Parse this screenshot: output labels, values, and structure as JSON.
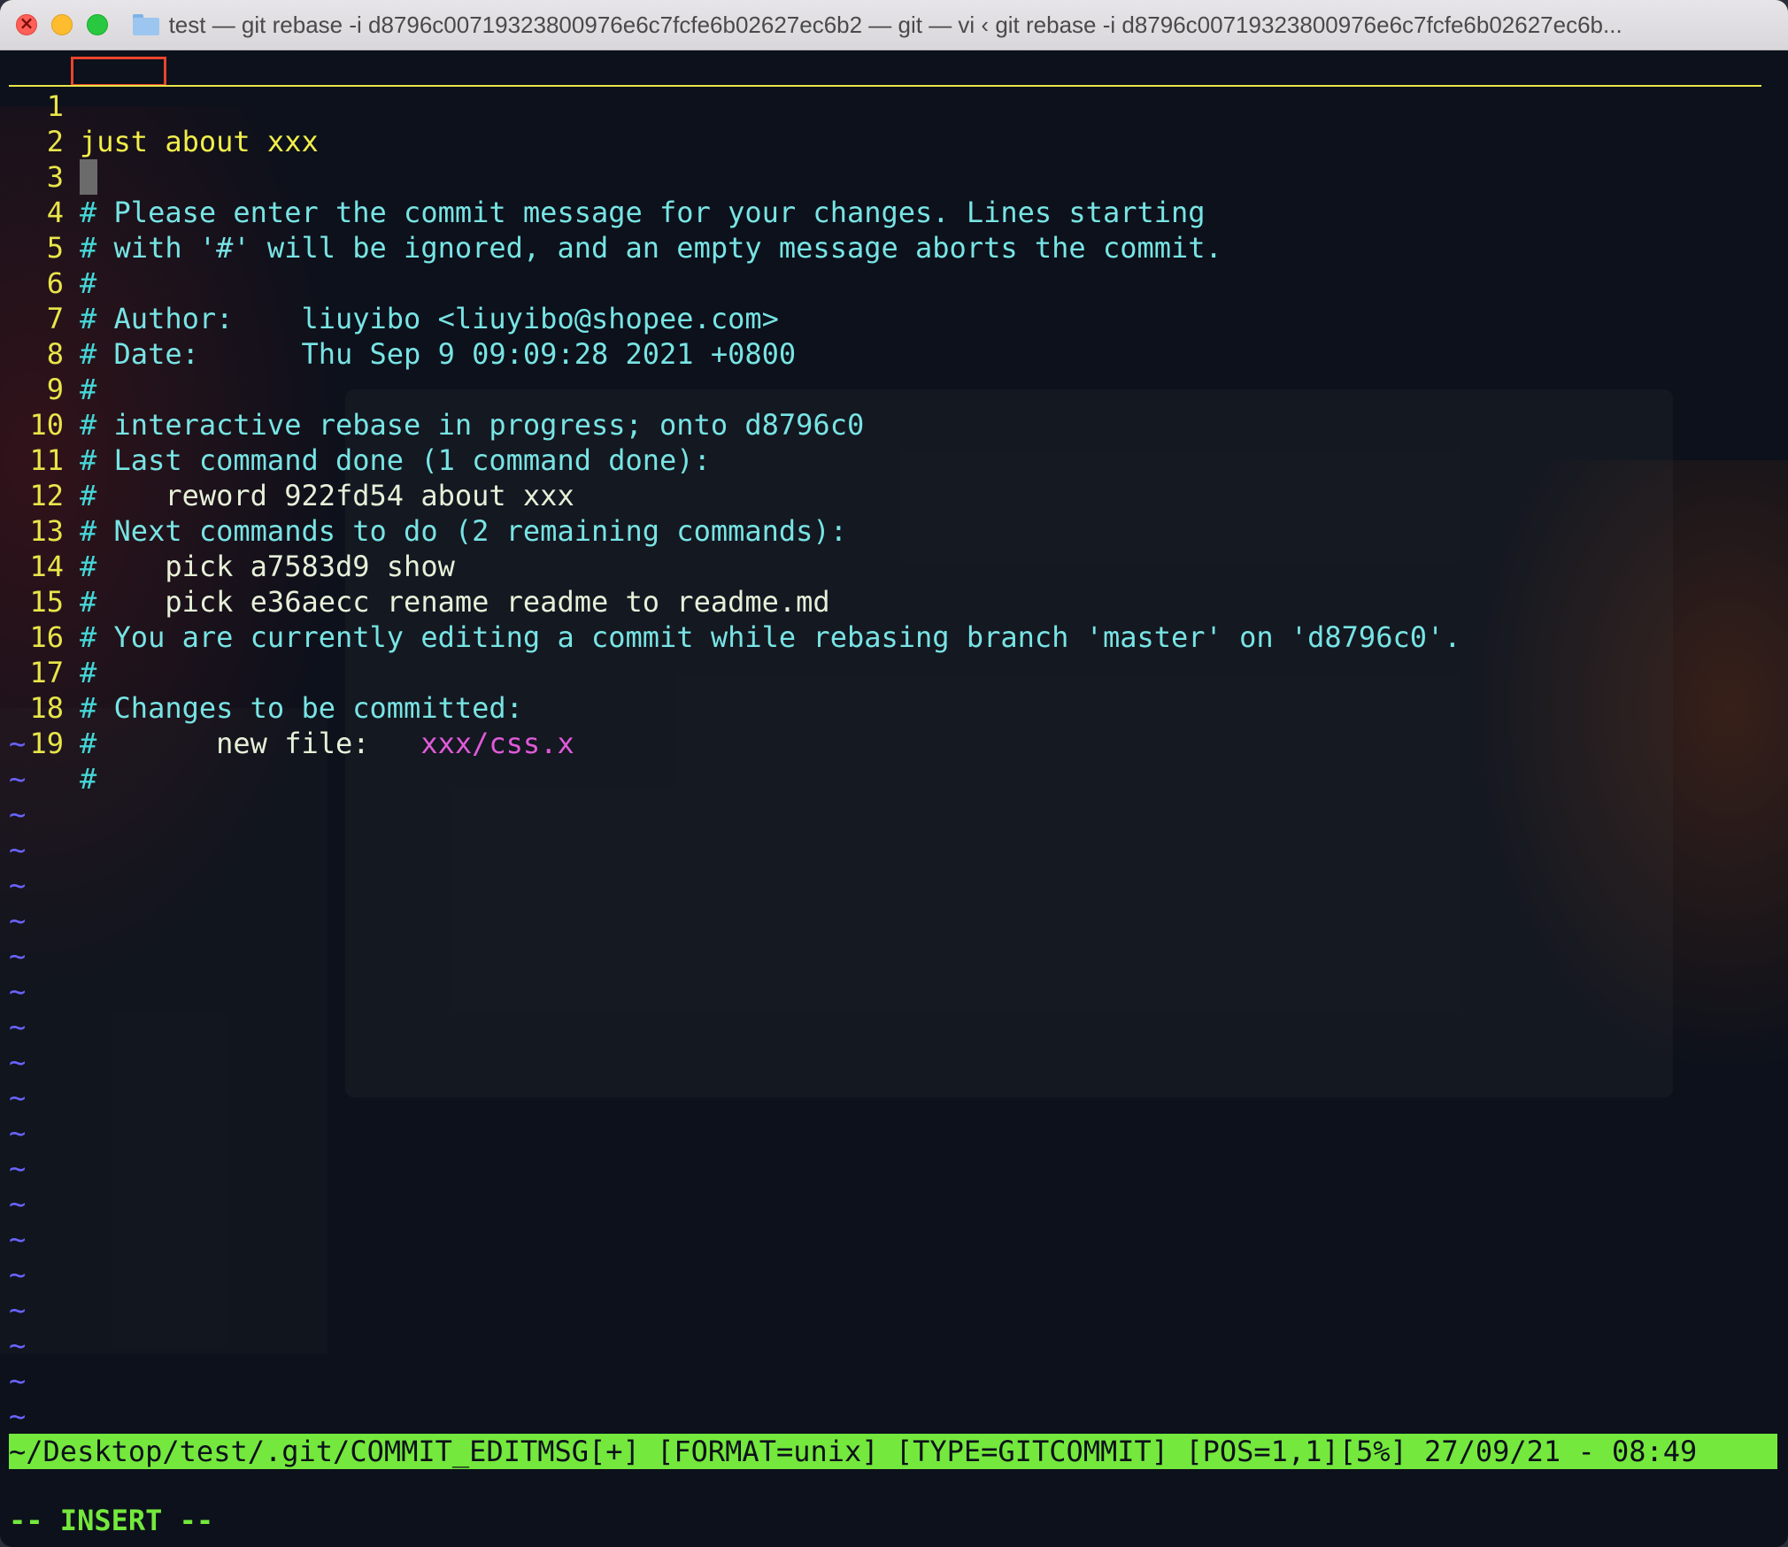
{
  "window": {
    "title": "test — git rebase -i d8796c00719323800976e6c7fcfe6b02627ec6b2 — git — vi ‹ git rebase -i d8796c00719323800976e6c7fcfe6b02627ec6b..."
  },
  "editor": {
    "line_numbers": [
      "1",
      "2",
      "3",
      "4",
      "5",
      "6",
      "7",
      "8",
      "9",
      "10",
      "11",
      "12",
      "13",
      "14",
      "15",
      "16",
      "17",
      "18",
      "19"
    ],
    "line1": {
      "cursor_word": "just",
      "rest": " about xxx"
    },
    "line3": {
      "hash": "#",
      "text": " Please enter the commit message for your changes. Lines starting"
    },
    "line4": {
      "hash": "#",
      "text": " with '#' will be ignored, and an empty message aborts the commit."
    },
    "line5": {
      "hash": "#"
    },
    "line6": {
      "hash": "#",
      "text": " Author:    liuyibo <liuyibo@shopee.com>"
    },
    "line7": {
      "hash": "#",
      "text": " Date:      Thu Sep 9 09:09:28 2021 +0800"
    },
    "line8": {
      "hash": "#"
    },
    "line9": {
      "hash": "#",
      "text": " interactive rebase in progress; onto d8796c0"
    },
    "line10": {
      "hash": "#",
      "text": " Last command done (1 command done):"
    },
    "line11": {
      "hash": "#",
      "text": "    reword 922fd54 about xxx"
    },
    "line12": {
      "hash": "#",
      "text": " Next commands to do (2 remaining commands):"
    },
    "line13": {
      "hash": "#",
      "text": "    pick a7583d9 show"
    },
    "line14": {
      "hash": "#",
      "text": "    pick e36aecc rename readme to readme.md"
    },
    "line15": {
      "hash": "#",
      "text": " You are currently editing a commit while rebasing branch 'master' on 'd8796c0'."
    },
    "line16": {
      "hash": "#"
    },
    "line17": {
      "hash": "#",
      "text": " Changes to be committed:"
    },
    "line18": {
      "hash": "#",
      "label": "       new file:   ",
      "file": "xxx/css.x"
    },
    "line19": {
      "hash": "#"
    },
    "tilde": "~"
  },
  "statusline": {
    "text": "~/Desktop/test/.git/COMMIT_EDITMSG[+] [FORMAT=unix] [TYPE=GITCOMMIT] [POS=1,1][5%] 27/09/21 - 08:49"
  },
  "mode": {
    "text": "-- INSERT --"
  },
  "colors": {
    "background": "#0c111b",
    "line_number": "#e8e54a",
    "comment": "#45d6d6",
    "tilde": "#6a63ff",
    "statusline": "#74e83c",
    "file_path": "#e05ad9",
    "cursor_box": "#e8452c"
  }
}
